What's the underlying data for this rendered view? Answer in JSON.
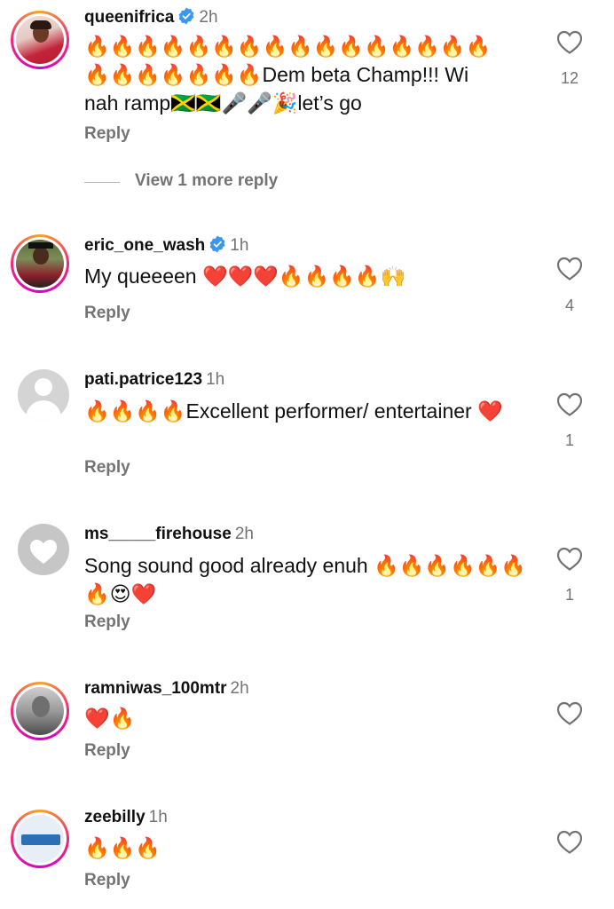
{
  "comments": [
    {
      "username": "queenifrica",
      "verified": true,
      "time": "2h",
      "text": "🔥🔥🔥🔥🔥🔥🔥🔥🔥🔥🔥🔥🔥🔥🔥🔥🔥🔥🔥🔥🔥🔥🔥Dem beta Champ!!! Wi nah ramp🇯🇲🇯🇲🎤🎤🎉let’s go",
      "reply": "Reply",
      "likes": "12",
      "view_more": "View 1 more reply"
    },
    {
      "username": "eric_one_wash",
      "verified": true,
      "time": "1h",
      "text": "My queeeen ❤️❤️❤️🔥🔥🔥🔥🙌",
      "reply": "Reply",
      "likes": "4"
    },
    {
      "username": "pati.patrice123",
      "verified": false,
      "time": "1h",
      "text": "🔥🔥🔥🔥Excellent performer/ entertainer ❤️",
      "reply": "Reply",
      "likes": "1"
    },
    {
      "username": "ms_____firehouse",
      "verified": false,
      "time": "2h",
      "text": "Song sound good already enuh 🔥🔥🔥🔥🔥🔥🔥😍❤️",
      "reply": "Reply",
      "likes": "1"
    },
    {
      "username": "ramniwas_100mtr",
      "verified": false,
      "time": "2h",
      "text": "❤️🔥",
      "reply": "Reply",
      "likes": ""
    },
    {
      "username": "zeebilly",
      "verified": false,
      "time": "1h",
      "text": "🔥🔥🔥",
      "reply": "Reply",
      "likes": ""
    }
  ],
  "colors": {
    "verified": "#3897f0",
    "secondary_text": "#737373",
    "story_ring": "#ee2a7b"
  },
  "icons": {
    "like": "heart-outline-icon",
    "verified": "verified-badge-icon",
    "default_avatar": "default-avatar-icon"
  }
}
